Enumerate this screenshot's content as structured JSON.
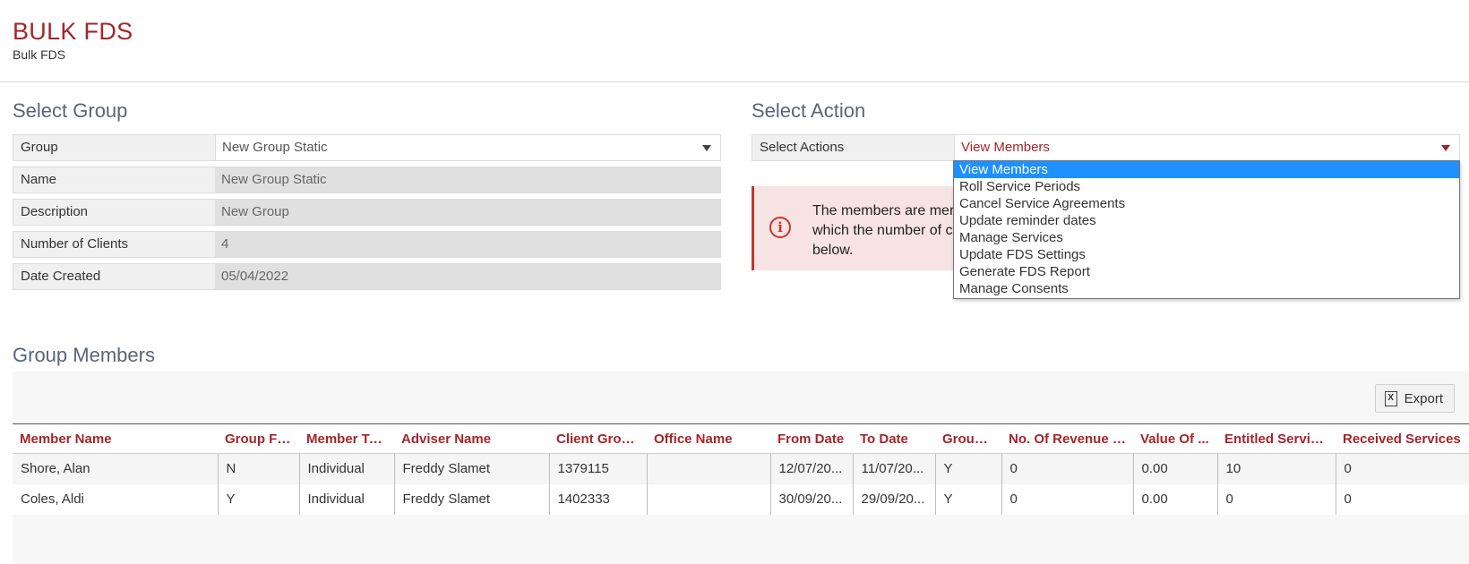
{
  "header": {
    "title": "BULK FDS",
    "subtitle": "Bulk FDS"
  },
  "select_group": {
    "title": "Select Group",
    "fields": [
      {
        "label": "Group",
        "value": "New Group Static"
      },
      {
        "label": "Name",
        "value": "New Group Static"
      },
      {
        "label": "Description",
        "value": "New Group"
      },
      {
        "label": "Number of Clients",
        "value": "4"
      },
      {
        "label": "Date Created",
        "value": "05/04/2022"
      }
    ]
  },
  "select_action": {
    "title": "Select Action",
    "label": "Select Actions",
    "value": "View Members",
    "options": [
      "View Members",
      "Roll Service Periods",
      "Cancel Service Agreements",
      "Update reminder dates",
      "Manage Services",
      "Update FDS Settings",
      "Generate FDS Report",
      "Manage Consents"
    ]
  },
  "alert": {
    "line1": "The members are merg",
    "line2": "which the number of cl",
    "line3": "below."
  },
  "members": {
    "title": "Group Members",
    "export_label": "Export",
    "columns": [
      "Member Name",
      "Group FDS",
      "Member Type",
      "Adviser Name",
      "Client Group ...",
      "Office Name",
      "From Date",
      "To Date",
      "Group By",
      "No. Of Revenue T...",
      "Value Of ...",
      "Entitled Services",
      "Received Services"
    ],
    "rows": [
      [
        "Shore, Alan",
        "N",
        "Individual",
        "Freddy Slamet",
        "1379115",
        "",
        "12/07/20...",
        "11/07/20...",
        "Y",
        "0",
        "0.00",
        "10",
        "0"
      ],
      [
        "Coles, Aldi",
        "Y",
        "Individual",
        "Freddy Slamet",
        "1402333",
        "",
        "30/09/20...",
        "29/09/20...",
        "Y",
        "0",
        "0.00",
        "0",
        "0"
      ]
    ]
  },
  "colors": {
    "accent": "#a3262a",
    "selection": "#1e90ff",
    "alert_bg": "#f8e3e4"
  }
}
